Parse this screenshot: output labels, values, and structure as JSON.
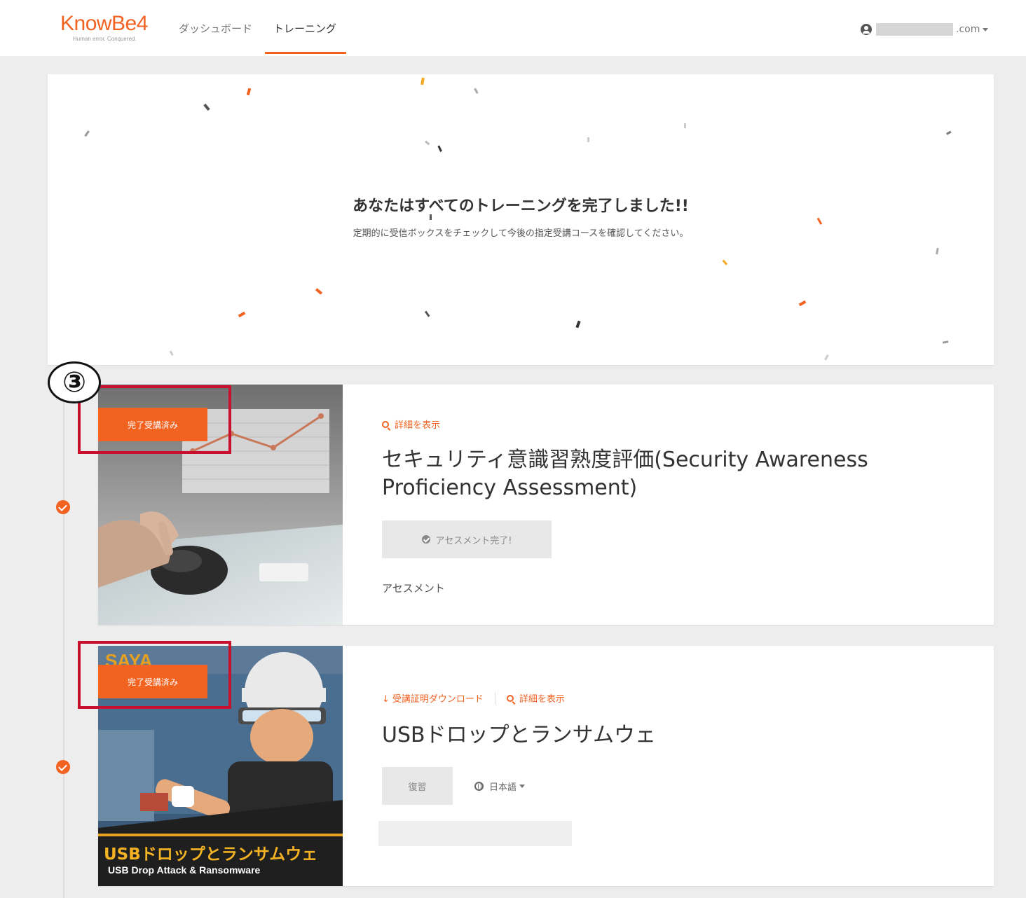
{
  "nav": {
    "logo_text": "KnowBe4",
    "logo_tagline": "Human error. Conquered.",
    "items": [
      {
        "label": "ダッシュボード"
      },
      {
        "label": "トレーニング"
      }
    ],
    "account_suffix": ".com",
    "accent_color": "#f26322"
  },
  "banner": {
    "title": "あなたはすべてのトレーニングを完了しました!!",
    "subtitle": "定期的に受信ボックスをチェックして今後の指定受講コースを確認してください。"
  },
  "annotation": {
    "number": "③",
    "color": "#c8102e"
  },
  "courses": [
    {
      "badge": "完了受講済み",
      "detail_link": "詳細を表示",
      "title_line1": "セキュリティ意識習熟度評価(Security Awareness",
      "title_line2": "Proficiency Assessment)",
      "button": "アセスメント完了!",
      "type": "アセスメント"
    },
    {
      "badge": "完了受講済み",
      "certificate_link": "受講証明ダウンロード",
      "detail_link": "詳細を表示",
      "title": "USBドロップとランサムウェ",
      "button": "復習",
      "language": "日本語",
      "thumb_caption_jp": "USBドロップとランサムウェ",
      "thumb_caption_en": "USB Drop Attack & Ransomware",
      "thumb_logo": "SAYA"
    }
  ]
}
